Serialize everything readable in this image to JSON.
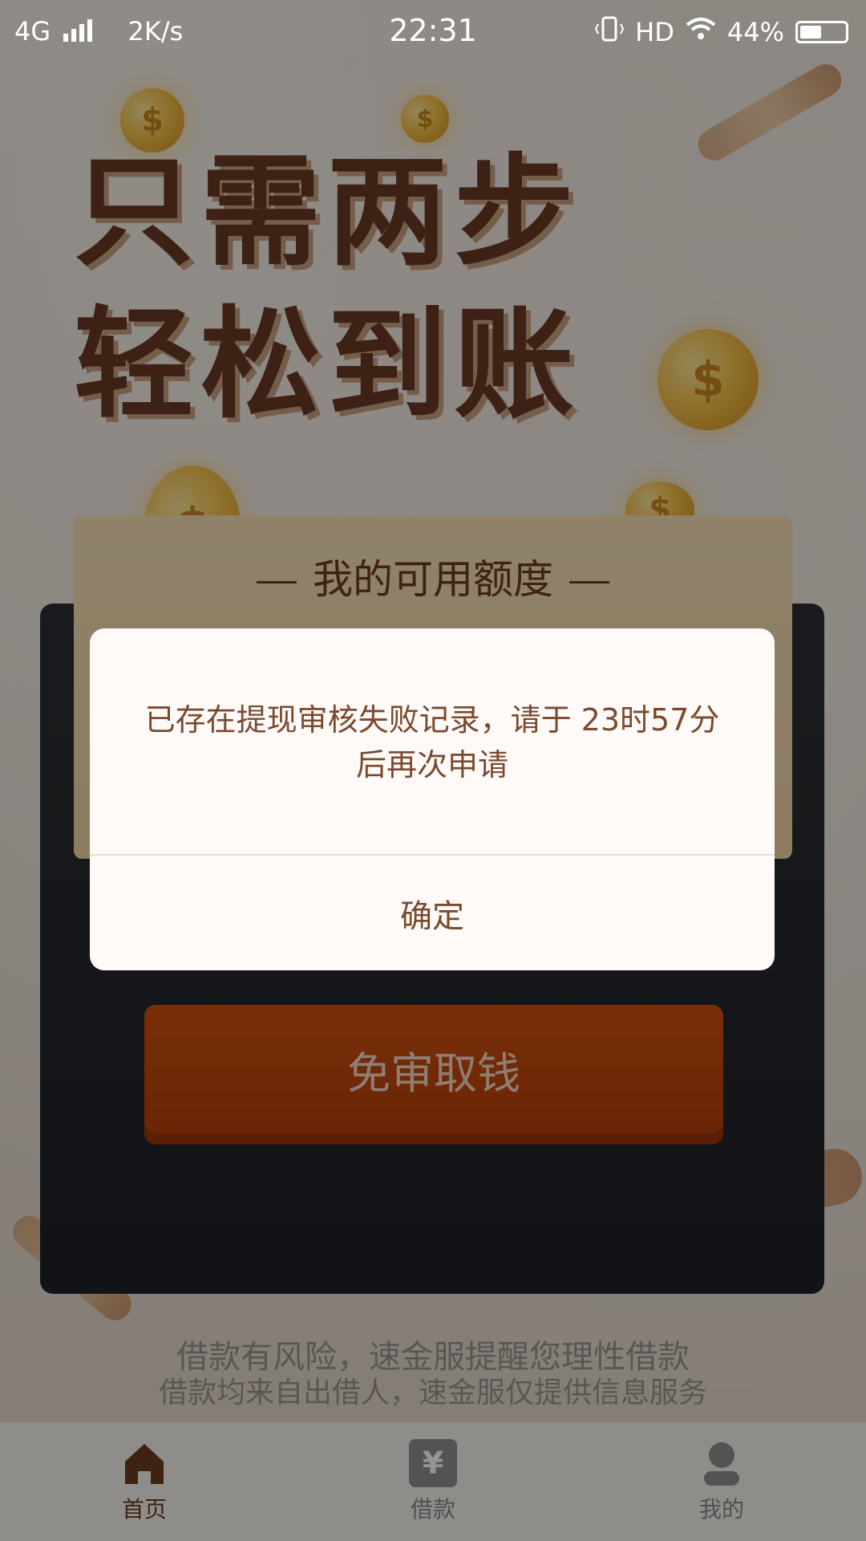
{
  "status_bar": {
    "network": "4G",
    "speed": "2K/s",
    "time": "22:31",
    "hd": "HD",
    "battery": "44%"
  },
  "hero": {
    "line1": "只需两步",
    "line2": "轻松到账"
  },
  "card": {
    "title": "我的可用额度",
    "cash_button": "免审取钱"
  },
  "disclaimer": {
    "line1": "借款有风险，速金服提醒您理性借款",
    "line2": "借款均来自出借人，速金服仅提供信息服务"
  },
  "tabs": [
    {
      "label": "首页",
      "icon": "home-icon",
      "active": true
    },
    {
      "label": "借款",
      "icon": "yuan-icon",
      "active": false
    },
    {
      "label": "我的",
      "icon": "user-icon",
      "active": false
    }
  ],
  "dialog": {
    "message_line1": "已存在提现审核失败记录，请于 23时57分",
    "message_line2": "后再次申请",
    "confirm": "确定"
  },
  "colors": {
    "accent": "#b9410a",
    "brown": "#6b3b1f"
  }
}
